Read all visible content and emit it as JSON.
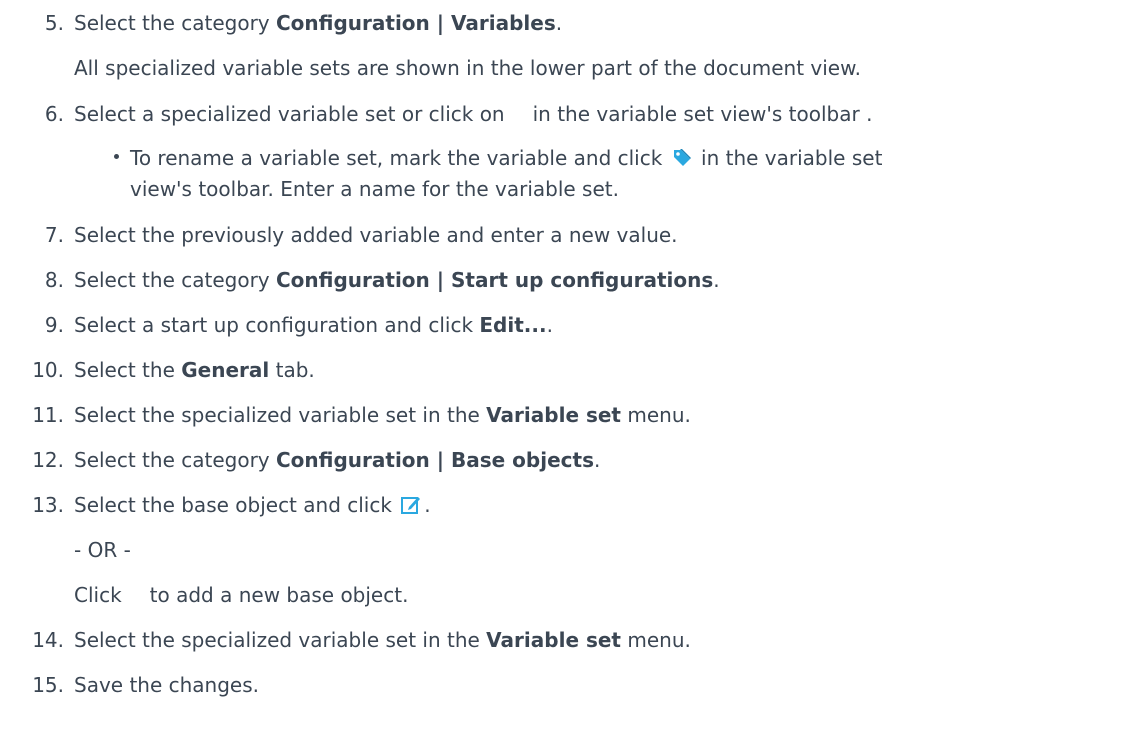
{
  "steps": [
    {
      "num": "5.",
      "pre": "Select the category ",
      "bold": "Configuration | Variables",
      "post": "."
    },
    {
      "note": "All specialized variable sets are shown in the lower part of the document view."
    },
    {
      "num": "6.",
      "pre": "Select a specialized variable set or click on",
      "post": "in the variable set view's toolbar ."
    },
    {
      "bullet_a": "To rename a variable set, mark the variable and click",
      "bullet_b": "in the variable set",
      "bullet_c": "view's toolbar. Enter a name for the variable set."
    },
    {
      "num": "7.",
      "text": "Select the previously added variable and enter a new value."
    },
    {
      "num": "8.",
      "pre": "Select the category ",
      "bold": "Configuration | Start up configurations",
      "post": "."
    },
    {
      "num": "9.",
      "pre": "Select a start up configuration and click ",
      "bold": "Edit...",
      "post": "."
    },
    {
      "num": "10.",
      "pre": "Select the ",
      "bold": "General",
      "post": " tab."
    },
    {
      "num": "11.",
      "pre": "Select the specialized variable set in the ",
      "bold": "Variable set",
      "post": " menu."
    },
    {
      "num": "12.",
      "pre": "Select the category ",
      "bold": "Configuration | Base objects",
      "post": "."
    },
    {
      "num": "13.",
      "pre": "Select the base object and click",
      "post": "."
    },
    {
      "or": "- OR -"
    },
    {
      "pre": "Click",
      "post": "to add a new base object."
    },
    {
      "num": "14.",
      "pre": "Select the specialized variable set in the ",
      "bold": "Variable set",
      "post": " menu."
    },
    {
      "num": "15.",
      "text": "Save the changes."
    }
  ],
  "icons": {
    "tag": "tag-icon",
    "edit": "edit-icon"
  },
  "colors": {
    "text": "#3b4653",
    "tag_icon": "#2aa8e0",
    "edit_icon": "#2aa8e0"
  }
}
